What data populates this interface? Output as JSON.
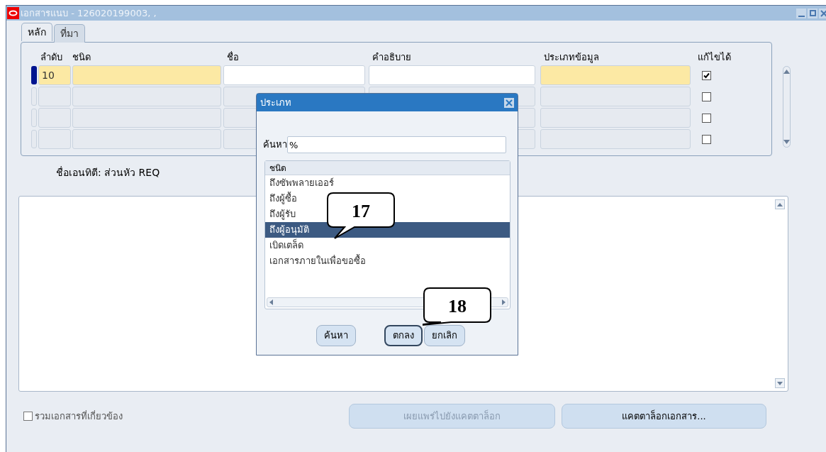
{
  "window": {
    "title": "เอกสารแนบ - 126020199003, ,"
  },
  "tabs": [
    {
      "label": "หลัก",
      "selected": true
    },
    {
      "label": "ที่มา",
      "selected": false
    }
  ],
  "table": {
    "columns": [
      "ลำดับ",
      "ชนิด",
      "ชื่อ",
      "คำอธิบาย",
      "ประเภทข้อมูล",
      "แก้ไขได้"
    ],
    "rows": [
      {
        "seq": "10",
        "selected": true,
        "editable": true
      },
      {
        "selected": false,
        "editable": false
      },
      {
        "selected": false,
        "editable": false
      },
      {
        "selected": false,
        "editable": false
      }
    ]
  },
  "entity_label": "ชื่อเอนทิตี: ส่วนหัว REQ",
  "dialog": {
    "title": "ประเภท",
    "search_label": "ค้นหา",
    "search_value": "%",
    "list_header": "ชนิด",
    "items": [
      {
        "label": "ถึงซัพพลายเออร์",
        "selected": false
      },
      {
        "label": "ถึงผู้ซื้อ",
        "selected": false
      },
      {
        "label": "ถึงผู้รับ",
        "selected": false
      },
      {
        "label": "ถึงผู้อนุมัติ",
        "selected": true
      },
      {
        "label": "เบิดเตล็ด",
        "selected": false
      },
      {
        "label": "เอกสารภายในเพื่อขอซื้อ",
        "selected": false
      }
    ],
    "buttons": [
      {
        "label": "ค้นหา",
        "focused": false
      },
      {
        "label": "ตกลง",
        "focused": true
      },
      {
        "label": "ยกเลิก",
        "focused": false
      }
    ]
  },
  "callouts": [
    {
      "text": "17"
    },
    {
      "text": "18"
    }
  ],
  "footer": {
    "checkbox": {
      "label": "รวมเอกสารที่เกี่ยวข้อง",
      "checked": false
    },
    "buttons": [
      {
        "label": "เผยแพร่ไปยังแคตตาล็อก",
        "disabled": true
      },
      {
        "label": "แคตตาล็อกเอกสาร...",
        "disabled": false
      }
    ]
  }
}
